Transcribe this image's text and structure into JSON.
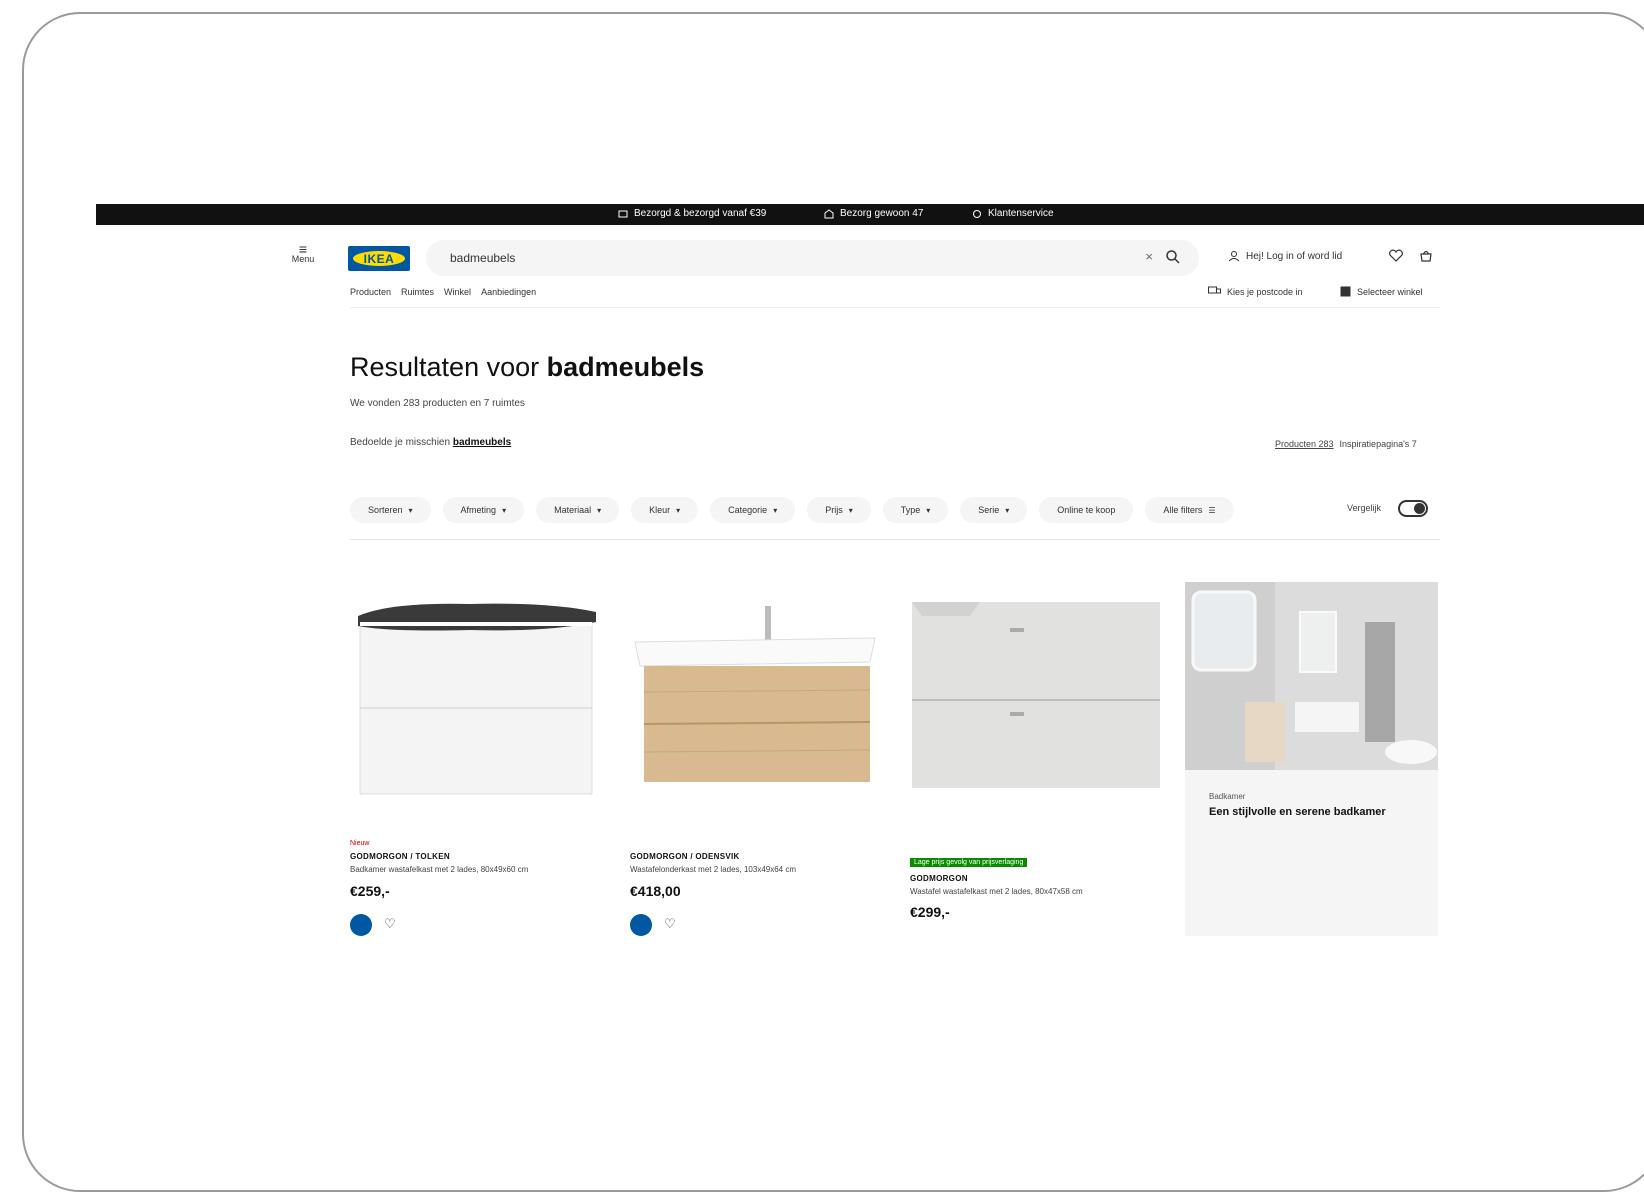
{
  "topbar": {
    "items": [
      {
        "icon": "truck-icon",
        "label": "Bezorgd & bezorgd vanaf €39"
      },
      {
        "icon": "store-icon",
        "label": "Bezorg gewoon 47"
      },
      {
        "icon": "phone-icon",
        "label": "Klantenservice"
      }
    ]
  },
  "header": {
    "menu_label": "Menu",
    "logo_text": "IKEA",
    "search_value": "badmeubels",
    "account_label": "Hej! Log in of word lid",
    "nav": [
      "Producten",
      "Ruimtes",
      "Winkel",
      "Aanbiedingen"
    ],
    "right_links": [
      "Kies je postcode in",
      "Selecteer winkel"
    ]
  },
  "results": {
    "title_prefix": "Resultaten voor",
    "title_query": "badmeubels",
    "subtitle": "We vonden 283 producten en 7 ruimtes",
    "suggest_prefix": "Bedoelde je misschien",
    "suggest_link": "badmeubels",
    "tab_products": "Producten 283",
    "tab_other": "Inspiratiepagina's 7"
  },
  "filters": {
    "items": [
      "Sorteren",
      "Afmeting",
      "Materiaal",
      "Kleur",
      "Categorie",
      "Prijs",
      "Type",
      "Serie",
      "Online te koop",
      "Alle filters"
    ],
    "toggle_label": "Vergelijk"
  },
  "products": [
    {
      "badge": "Nieuw",
      "name": "GODMORGON / TOLKEN",
      "desc": "Badkamer wastafelkast met 2 lades, 80x49x60 cm",
      "price": "€259,-"
    },
    {
      "badge": "",
      "name": "GODMORGON / ODENSVIK",
      "desc": "Wastafelonderkast met 2 lades, 103x49x64 cm",
      "price": "€418,00"
    },
    {
      "badge": "Lage prijs gevolg van prijsverlaging",
      "name": "GODMORGON",
      "desc": "Wastafel wastafelkast met 2 lades, 80x47x58 cm",
      "price": "€299,-"
    }
  ],
  "promo": {
    "label": "Badkamer",
    "title": "Een stijlvolle en serene badkamer"
  },
  "colors": {
    "ikea_blue": "#0058a3",
    "ikea_yellow": "#ffdb00",
    "sale_red": "#cc0008",
    "badge_green": "#0a8a00"
  }
}
